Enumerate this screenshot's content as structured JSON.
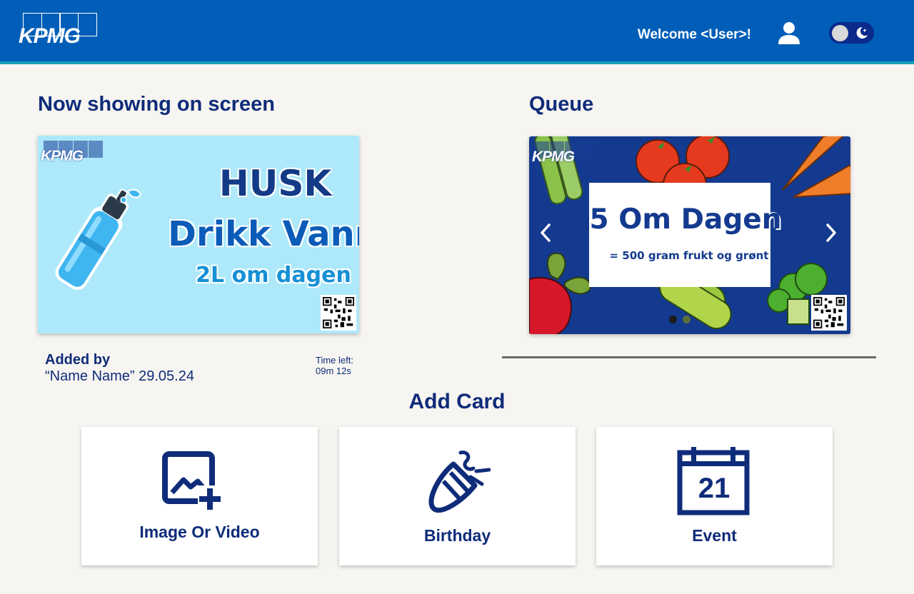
{
  "header": {
    "logo_text": "KPMG",
    "welcome": "Welcome <User>!",
    "icons": {
      "user": "user-icon",
      "theme": "theme-toggle-moon-icon"
    }
  },
  "now_showing": {
    "title": "Now showing on screen",
    "card": {
      "logo_text": "KPMG",
      "line1": "HUSK",
      "line2": "Drikk Vann",
      "line3": "2L om dagen"
    },
    "added_by_label": "Added by",
    "added_by_value": "“Name Name” 29.05.24",
    "time_left_label": "Time left:",
    "time_left_value": "09m 12s"
  },
  "queue": {
    "title": "Queue",
    "card": {
      "logo_text": "KPMG",
      "headline": "5 Om Dagen",
      "subline": "= 500 gram frukt og grønt"
    },
    "carousel": {
      "current": 1,
      "total": 2
    }
  },
  "add_card": {
    "title": "Add Card",
    "options": [
      {
        "label": "Image Or Video",
        "icon": "image-add-icon"
      },
      {
        "label": "Birthday",
        "icon": "party-popper-icon"
      },
      {
        "label": "Event",
        "icon": "calendar-icon",
        "icon_text": "21"
      }
    ]
  },
  "colors": {
    "header_bg": "#005eb8",
    "accent": "#17a2b8",
    "text_primary": "#0f2c7a",
    "background": "#f7f5f1"
  }
}
